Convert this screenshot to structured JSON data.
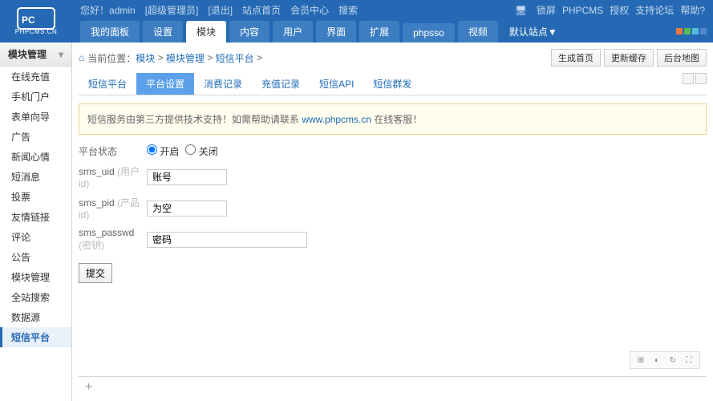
{
  "header": {
    "greeting": "您好！",
    "username": "admin",
    "role": "[超级管理员]",
    "logout": "[退出]",
    "links": [
      "站点首页",
      "会员中心",
      "搜索"
    ],
    "right_links": [
      "锁屏",
      "PHPCMS",
      "授权",
      "支持论坛",
      "帮助?"
    ],
    "logo_sub": "PHPCMS.CN"
  },
  "nav": {
    "tabs": [
      "我的面板",
      "设置",
      "模块",
      "内容",
      "用户",
      "界面",
      "扩展",
      "phpsso",
      "视频"
    ],
    "site_select": "默认站点▼"
  },
  "sidebar": {
    "title": "模块管理",
    "items": [
      "在线充值",
      "手机门户",
      "表单向导",
      "广告",
      "新闻心情",
      "短消息",
      "投票",
      "友情链接",
      "评论",
      "公告",
      "模块管理",
      "全站搜索",
      "数据源",
      "短信平台"
    ]
  },
  "breadcrumb": {
    "label": "当前位置：",
    "parts": [
      "模块",
      "模块管理",
      "短信平台"
    ],
    "buttons": [
      "生成首页",
      "更新缓存",
      "后台地图"
    ]
  },
  "subtabs": [
    "短信平台",
    "平台设置",
    "消费记录",
    "充值记录",
    "短信API",
    "短信群发"
  ],
  "notice": {
    "text1": "短信服务由第三方提供技术支持！如需帮助请联系 ",
    "link": "www.phpcms.cn",
    "text2": " 在线客服！"
  },
  "form": {
    "status_label": "平台状态",
    "radio_on": "开启",
    "radio_off": "关闭",
    "uid_label": "sms_uid",
    "uid_hint": "(用户id)",
    "uid_value": "账号",
    "pid_label": "sms_pid",
    "pid_hint": "(产品id)",
    "pid_value": "为空",
    "pwd_label": "sms_passwd",
    "pwd_hint": "(密钥)",
    "pwd_value": "密码",
    "submit": "提交"
  }
}
